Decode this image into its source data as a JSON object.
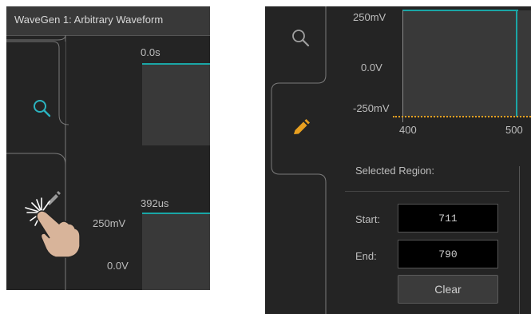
{
  "left_panel": {
    "title": "WaveGen 1: Arbitrary Waveform",
    "top_plot": {
      "time_label": "0.0s"
    },
    "bottom_plot": {
      "time_label": "392us",
      "v_top": "250mV",
      "v_bottom": "0.0V"
    },
    "tabs": [
      {
        "icon": "search-icon",
        "active": true
      },
      {
        "icon": "pencil-icon",
        "active": false
      }
    ]
  },
  "right_panel": {
    "plot": {
      "v_top": "250mV",
      "v_mid": "0.0V",
      "v_bottom": "-250mV",
      "x_tick_1": "400",
      "x_tick_2": "500"
    },
    "section_title": "Selected Region:",
    "start_label": "Start:",
    "start_value": "711",
    "end_label": "End:",
    "end_value": "790",
    "clear_label": "Clear",
    "tabs": [
      {
        "icon": "search-icon",
        "active": false
      },
      {
        "icon": "pencil-icon",
        "active": true
      }
    ]
  },
  "colors": {
    "accent_teal": "#2bb3bf",
    "accent_orange": "#e8a020",
    "panel_bg": "#242424",
    "trace_teal": "#1aa6a6"
  }
}
